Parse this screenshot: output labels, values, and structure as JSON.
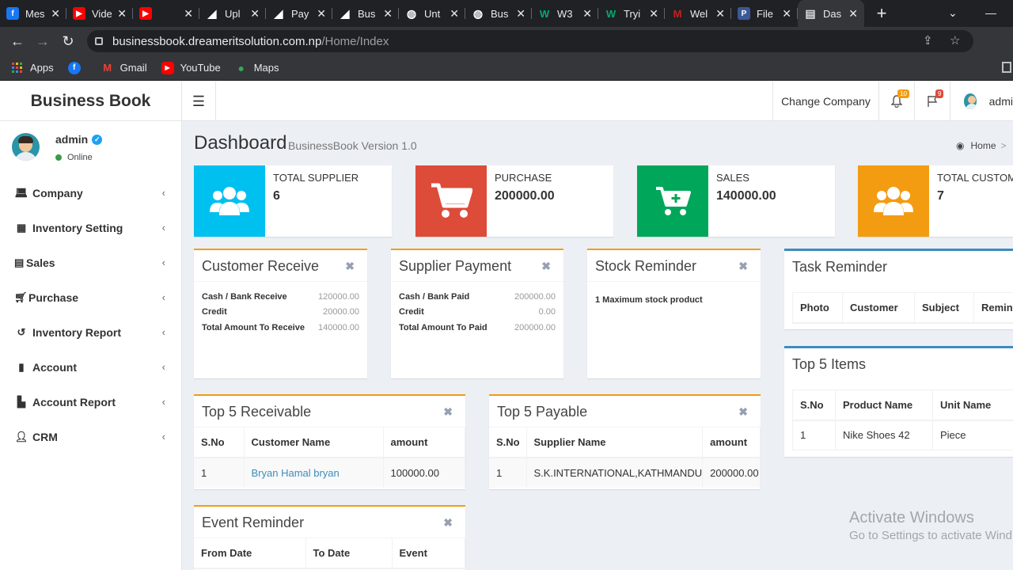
{
  "browser": {
    "tabs": [
      {
        "title": "Mes",
        "icon": "facebook-icon",
        "color": "#1877f2"
      },
      {
        "title": "Vide",
        "icon": "youtube-icon",
        "color": "#ff0000"
      },
      {
        "title": "",
        "icon": "youtube-icon",
        "color": "#ff0000"
      },
      {
        "title": "Upl",
        "icon": "doc-icon",
        "color": "#ffffff"
      },
      {
        "title": "Pay",
        "icon": "doc-icon",
        "color": "#ffffff"
      },
      {
        "title": "Bus",
        "icon": "doc-icon",
        "color": "#ffffff"
      },
      {
        "title": "Unt",
        "icon": "globe-icon",
        "color": "#ffffff"
      },
      {
        "title": "Bus",
        "icon": "globe-icon",
        "color": "#ffffff"
      },
      {
        "title": "W3",
        "icon": "w3schools-icon",
        "color": "#04aa6d"
      },
      {
        "title": "Tryi",
        "icon": "w3schools-icon",
        "color": "#04aa6d"
      },
      {
        "title": "Wel",
        "icon": "gmail-icon",
        "color": "#c5221f"
      },
      {
        "title": "File",
        "icon": "p-icon",
        "color": "#3b5998"
      },
      {
        "title": "Das",
        "icon": "page-icon",
        "color": "#dadce0"
      }
    ],
    "url_host": "businessbook.dreameritsolution.com.np",
    "url_path": "/Home/Index",
    "bookmarks": [
      {
        "label": "Apps",
        "icon": "apps-grid-icon"
      },
      {
        "label": "",
        "icon": "facebook-icon"
      },
      {
        "label": "Gmail",
        "icon": "gmail-icon"
      },
      {
        "label": "YouTube",
        "icon": "youtube-icon"
      },
      {
        "label": "Maps",
        "icon": "maps-icon"
      }
    ]
  },
  "app": {
    "logo": "Business Book",
    "change_company": "Change Company",
    "notif_count": "10",
    "flag_count": "9",
    "user_label": "admi"
  },
  "sidebar": {
    "user_name": "admin",
    "status": "Online",
    "items": [
      {
        "label": "Company",
        "icon": "laptop-icon"
      },
      {
        "label": "Inventory Setting",
        "icon": "grid-icon"
      },
      {
        "label": "Sales",
        "icon": "file-icon"
      },
      {
        "label": "Purchase",
        "icon": "cart-icon"
      },
      {
        "label": "Inventory Report",
        "icon": "history-icon"
      },
      {
        "label": "Account",
        "icon": "book-icon"
      },
      {
        "label": "Account Report",
        "icon": "report-icon"
      },
      {
        "label": "CRM",
        "icon": "user-plus-icon"
      }
    ]
  },
  "page": {
    "title": "Dashboard",
    "subtitle": "BusinessBook Version 1.0",
    "breadcrumb_home": "Home"
  },
  "info_boxes": [
    {
      "label": "TOTAL SUPPLIER",
      "value": "6",
      "color": "#00c0ef",
      "icon": "users-icon"
    },
    {
      "label": "PURCHASE",
      "value": "200000.00",
      "color": "#dd4b39",
      "icon": "cart-icon"
    },
    {
      "label": "SALES",
      "value": "140000.00",
      "color": "#00a65a",
      "icon": "cart-plus-icon"
    },
    {
      "label": "TOTAL CUSTOMERS",
      "value": "7",
      "color": "#f39c12",
      "icon": "users-icon"
    }
  ],
  "customer_receive": {
    "title": "Customer Receive",
    "rows": [
      {
        "k": "Cash / Bank Receive",
        "v": "120000.00"
      },
      {
        "k": "Credit",
        "v": "20000.00"
      },
      {
        "k": "Total Amount To Receive",
        "v": "140000.00"
      }
    ]
  },
  "supplier_payment": {
    "title": "Supplier Payment",
    "rows": [
      {
        "k": "Cash / Bank Paid",
        "v": "200000.00"
      },
      {
        "k": "Credit",
        "v": "0.00"
      },
      {
        "k": "Total Amount To Paid",
        "v": "200000.00"
      }
    ]
  },
  "stock_reminder": {
    "title": "Stock Reminder",
    "text": "1 Maximum stock product"
  },
  "task_reminder": {
    "title": "Task Reminder",
    "headers": [
      "Photo",
      "Customer",
      "Subject",
      "Remin"
    ]
  },
  "top_receivable": {
    "title": "Top 5 Receivable",
    "headers": [
      "S.No",
      "Customer Name",
      "amount"
    ],
    "rows": [
      [
        "1",
        "Bryan Hamal bryan",
        "100000.00"
      ]
    ]
  },
  "top_payable": {
    "title": "Top 5 Payable",
    "headers": [
      "S.No",
      "Supplier Name",
      "amount"
    ],
    "rows": [
      [
        "1",
        "S.K.INTERNATIONAL,KATHMANDU",
        "200000.00"
      ]
    ]
  },
  "top_items": {
    "title": "Top 5 Items",
    "headers": [
      "S.No",
      "Product Name",
      "Unit Name"
    ],
    "rows": [
      [
        "1",
        "Nike Shoes 42",
        "Piece"
      ]
    ]
  },
  "event_reminder": {
    "title": "Event Reminder",
    "headers": [
      "From Date",
      "To Date",
      "Event"
    ]
  },
  "watermark": {
    "line1": "Activate Windows",
    "line2": "Go to Settings to activate Wind"
  }
}
